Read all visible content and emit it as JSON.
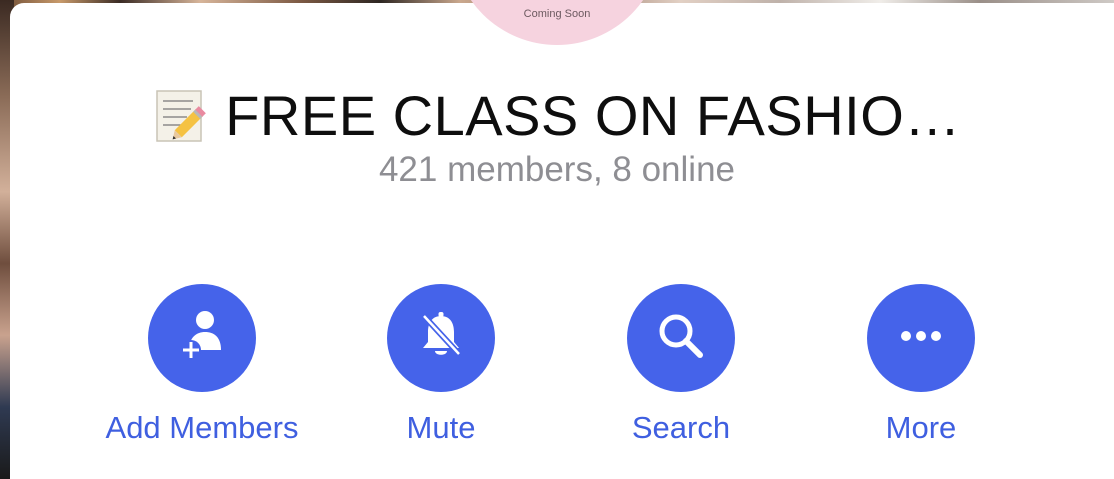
{
  "avatar": {
    "caption": "Coming Soon"
  },
  "group": {
    "title": "FREE CLASS ON FASHIO…",
    "title_icon": "memo-icon",
    "subtitle": "421 members, 8 online"
  },
  "actions": [
    {
      "label": "Add Members",
      "icon": "add-member-icon"
    },
    {
      "label": "Mute",
      "icon": "bell-slash-icon"
    },
    {
      "label": "Search",
      "icon": "search-icon"
    },
    {
      "label": "More",
      "icon": "ellipsis-icon"
    }
  ],
  "colors": {
    "accent": "#4563ea",
    "label": "#3f5fe0",
    "subtitle": "#8e8e93",
    "avatar_bg": "#f6d3df"
  }
}
